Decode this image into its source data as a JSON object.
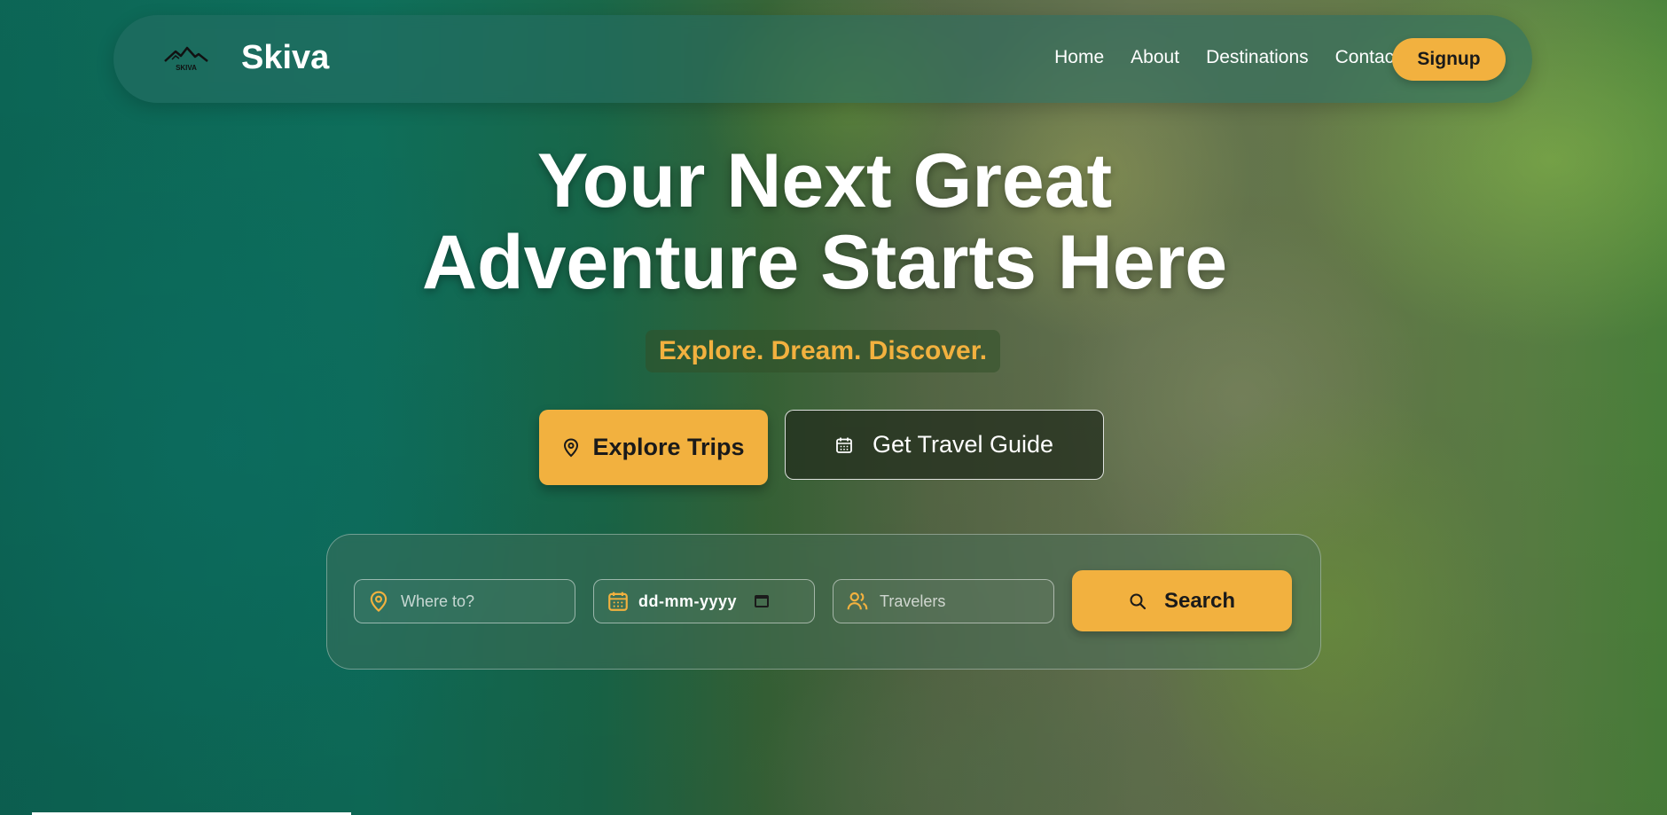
{
  "nav": {
    "logo_text": "SKIVA",
    "brand": "Skiva",
    "links": [
      "Home",
      "About",
      "Destinations",
      "Contact"
    ],
    "signup_label": "Signup"
  },
  "hero": {
    "title_line1": "Your Next Great",
    "title_line2": "Adventure Starts Here",
    "tagline": "Explore. Dream. Discover.",
    "primary_button": {
      "label": "Explore Trips",
      "icon": "map-pin-icon"
    },
    "secondary_button": {
      "label": "Get Travel Guide",
      "icon": "calendar-icon"
    }
  },
  "search": {
    "destination": {
      "placeholder": "Where to?",
      "icon": "map-pin-icon"
    },
    "date": {
      "value": "dd-mm-yyyy",
      "icon": "calendar-icon"
    },
    "travelers": {
      "placeholder": "Travelers",
      "icon": "users-icon"
    },
    "button": {
      "label": "Search",
      "icon": "search-icon"
    }
  },
  "colors": {
    "accent": "#f2b13f",
    "text": "#ffffff",
    "dark_text": "#1a1a1a"
  }
}
